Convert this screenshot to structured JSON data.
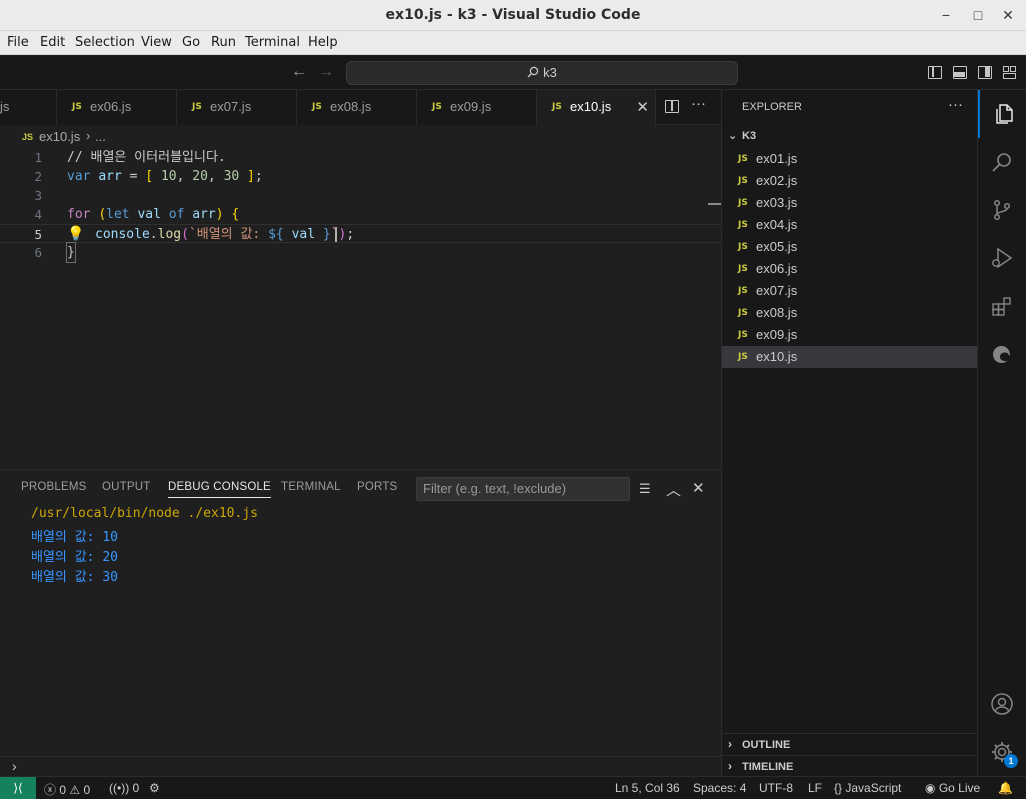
{
  "window": {
    "title": "ex10.js - k3 - Visual Studio Code"
  },
  "menu": [
    "File",
    "Edit",
    "Selection",
    "View",
    "Go",
    "Run",
    "Terminal",
    "Help"
  ],
  "command_center": {
    "text": "k3"
  },
  "tabs": [
    {
      "label": "js",
      "active": false
    },
    {
      "label": "ex06.js",
      "active": false
    },
    {
      "label": "ex07.js",
      "active": false
    },
    {
      "label": "ex08.js",
      "active": false
    },
    {
      "label": "ex09.js",
      "active": false
    },
    {
      "label": "ex10.js",
      "active": true
    }
  ],
  "breadcrumb": {
    "file": "ex10.js",
    "rest": "..."
  },
  "editor": {
    "line_numbers": [
      "1",
      "2",
      "3",
      "4",
      "5",
      "6"
    ],
    "current_line": "5",
    "lines": [
      "// 배열은 이터러블입니다.",
      "var arr = [ 10, 20, 30 ];",
      "",
      "for (let val of arr) {",
      "    console.log(`배열의 값: ${ val }`);",
      "}"
    ]
  },
  "panel": {
    "tabs": [
      "PROBLEMS",
      "OUTPUT",
      "DEBUG CONSOLE",
      "TERMINAL",
      "PORTS"
    ],
    "active_tab": "DEBUG CONSOLE",
    "filter_placeholder": "Filter (e.g. text, !exclude)",
    "output": [
      "/usr/local/bin/node ./ex10.js",
      "배열의 값: 10",
      "배열의 값: 20",
      "배열의 값: 30"
    ]
  },
  "explorer": {
    "title": "EXPLORER",
    "folder": "K3",
    "files": [
      "ex01.js",
      "ex02.js",
      "ex03.js",
      "ex04.js",
      "ex05.js",
      "ex06.js",
      "ex07.js",
      "ex08.js",
      "ex09.js",
      "ex10.js"
    ],
    "selected": "ex10.js",
    "sections": [
      "OUTLINE",
      "TIMELINE"
    ]
  },
  "activity_bar": {
    "icons": [
      "files-icon",
      "search-icon",
      "source-control-icon",
      "run-debug-icon",
      "extensions-icon",
      "edge-devtools-icon",
      "account-icon",
      "settings-gear-icon"
    ],
    "settings_badge": "1"
  },
  "status_bar": {
    "errors": "0",
    "warnings": "0",
    "ports": "0",
    "position": "Ln 5, Col 36",
    "spaces": "Spaces: 4",
    "encoding": "UTF-8",
    "eol": "LF",
    "language": "JavaScript",
    "go_live": "Go Live"
  },
  "colors": {
    "accent": "#0078d4",
    "remote": "#16825d",
    "js_icon": "#cbcb41"
  }
}
